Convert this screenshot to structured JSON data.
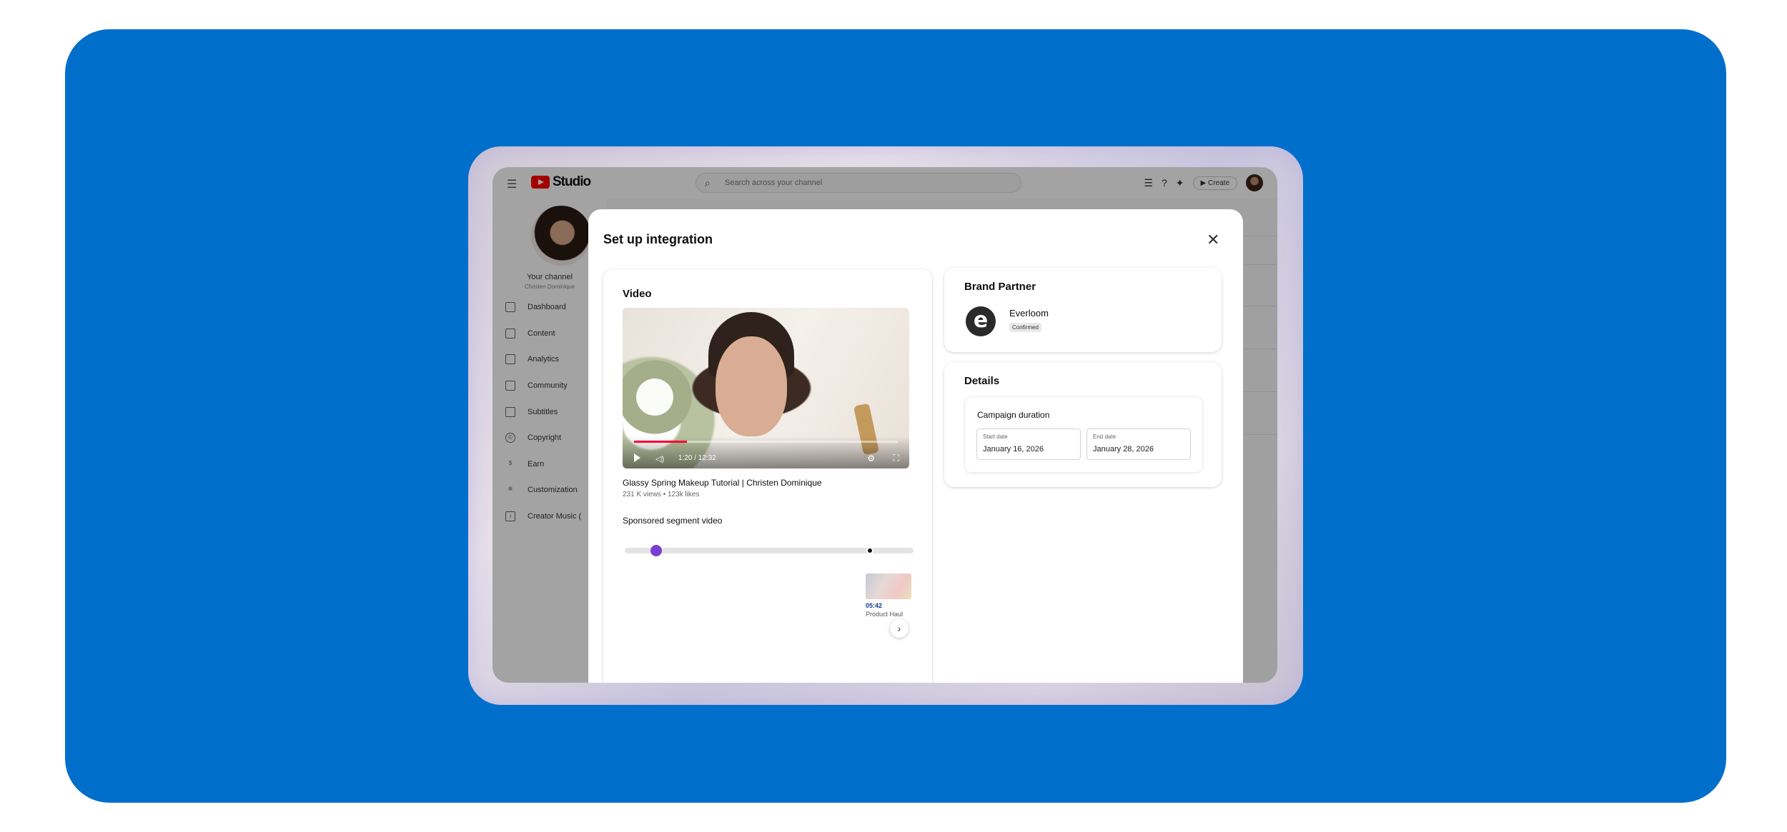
{
  "studio": {
    "logo_text": "Studio",
    "search_placeholder": "Search across your channel",
    "create_label": "Create",
    "channel_name": "Your channel",
    "channel_handle": "Christen Dominique",
    "nav": [
      {
        "label": "Dashboard",
        "icon": "dashboard-icon"
      },
      {
        "label": "Content",
        "icon": "content-icon"
      },
      {
        "label": "Analytics",
        "icon": "analytics-icon"
      },
      {
        "label": "Community",
        "icon": "community-icon"
      },
      {
        "label": "Subtitles",
        "icon": "subtitles-icon"
      },
      {
        "label": "Copyright",
        "icon": "copyright-icon"
      },
      {
        "label": "Earn",
        "icon": "earn-icon"
      },
      {
        "label": "Customization",
        "icon": "customization-icon"
      },
      {
        "label": "Creator Music (",
        "icon": "music-icon"
      }
    ]
  },
  "modal": {
    "title": "Set up integration",
    "video": {
      "heading": "Video",
      "time_display": "1:20 / 12:32",
      "playback_progress": 0.2,
      "title": "Glassy Spring Makeup Tutorial | Christen Dominique",
      "meta": "231 K views • 123k likes",
      "segment_label": "Sponsored segment video",
      "segment_start_fraction": 0.11,
      "segment_end_fraction": 0.85,
      "chapter": {
        "time": "05:42",
        "name": "Product Haul"
      }
    },
    "brand": {
      "heading": "Brand Partner",
      "logo_letter": "e",
      "name": "Everloom",
      "status": "Confirmed"
    },
    "details": {
      "heading": "Details",
      "campaign_title": "Campaign duration",
      "start_label": "Start date",
      "start_value": "January 16, 2026",
      "end_label": "End date",
      "end_value": "January 28, 2026"
    }
  },
  "colors": {
    "background": "#006fcb",
    "accent_purple": "#7a3fd1",
    "youtube_red": "#ff0000"
  }
}
